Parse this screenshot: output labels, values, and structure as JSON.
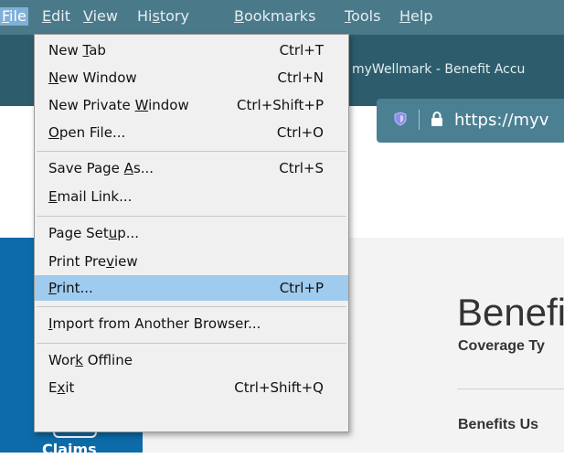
{
  "menubar": {
    "items": [
      {
        "pre": "",
        "u": "F",
        "post": "ile",
        "active": true
      },
      {
        "pre": "",
        "u": "E",
        "post": "dit"
      },
      {
        "pre": "",
        "u": "V",
        "post": "iew"
      },
      {
        "pre": "Hi",
        "u": "s",
        "post": "tory"
      },
      {
        "pre": "",
        "u": "B",
        "post": "ookmarks"
      },
      {
        "pre": "",
        "u": "T",
        "post": "ools"
      },
      {
        "pre": "",
        "u": "H",
        "post": "elp"
      }
    ]
  },
  "browser": {
    "tab_title": "myWellmark - Benefit Accu",
    "url": "https://myv"
  },
  "file_menu": {
    "items": [
      {
        "pre": "New ",
        "u": "T",
        "post": "ab",
        "shortcut": "Ctrl+T"
      },
      {
        "pre": "",
        "u": "N",
        "post": "ew Window",
        "shortcut": "Ctrl+N"
      },
      {
        "pre": "New Private ",
        "u": "W",
        "post": "indow",
        "shortcut": "Ctrl+Shift+P"
      },
      {
        "pre": "",
        "u": "O",
        "post": "pen File...",
        "shortcut": "Ctrl+O"
      },
      {
        "pre": "Save Page ",
        "u": "A",
        "post": "s...",
        "shortcut": "Ctrl+S"
      },
      {
        "pre": "",
        "u": "E",
        "post": "mail Link...",
        "shortcut": ""
      },
      {
        "pre": "Page Set",
        "u": "u",
        "post": "p...",
        "shortcut": ""
      },
      {
        "pre": "Print Pre",
        "u": "v",
        "post": "iew",
        "shortcut": ""
      },
      {
        "pre": "",
        "u": "P",
        "post": "rint...",
        "shortcut": "Ctrl+P",
        "highlight": true
      },
      {
        "pre": "",
        "u": "I",
        "post": "mport from Another Browser...",
        "shortcut": ""
      },
      {
        "pre": "Wor",
        "u": "k",
        "post": " Offline",
        "shortcut": ""
      },
      {
        "pre": "E",
        "u": "x",
        "post": "it",
        "shortcut": "Ctrl+Shift+Q"
      }
    ]
  },
  "page": {
    "heading": "Benefi",
    "coverage_label": "Coverage Ty",
    "benefits_used_label": "Benefits Us",
    "sidebar_claims_label": "Claims"
  },
  "colors": {
    "menubar": "#4a7a8a",
    "highlight": "#9fcbef",
    "sidebar": "#0c6ba8",
    "chrome": "#2d5d6c"
  }
}
